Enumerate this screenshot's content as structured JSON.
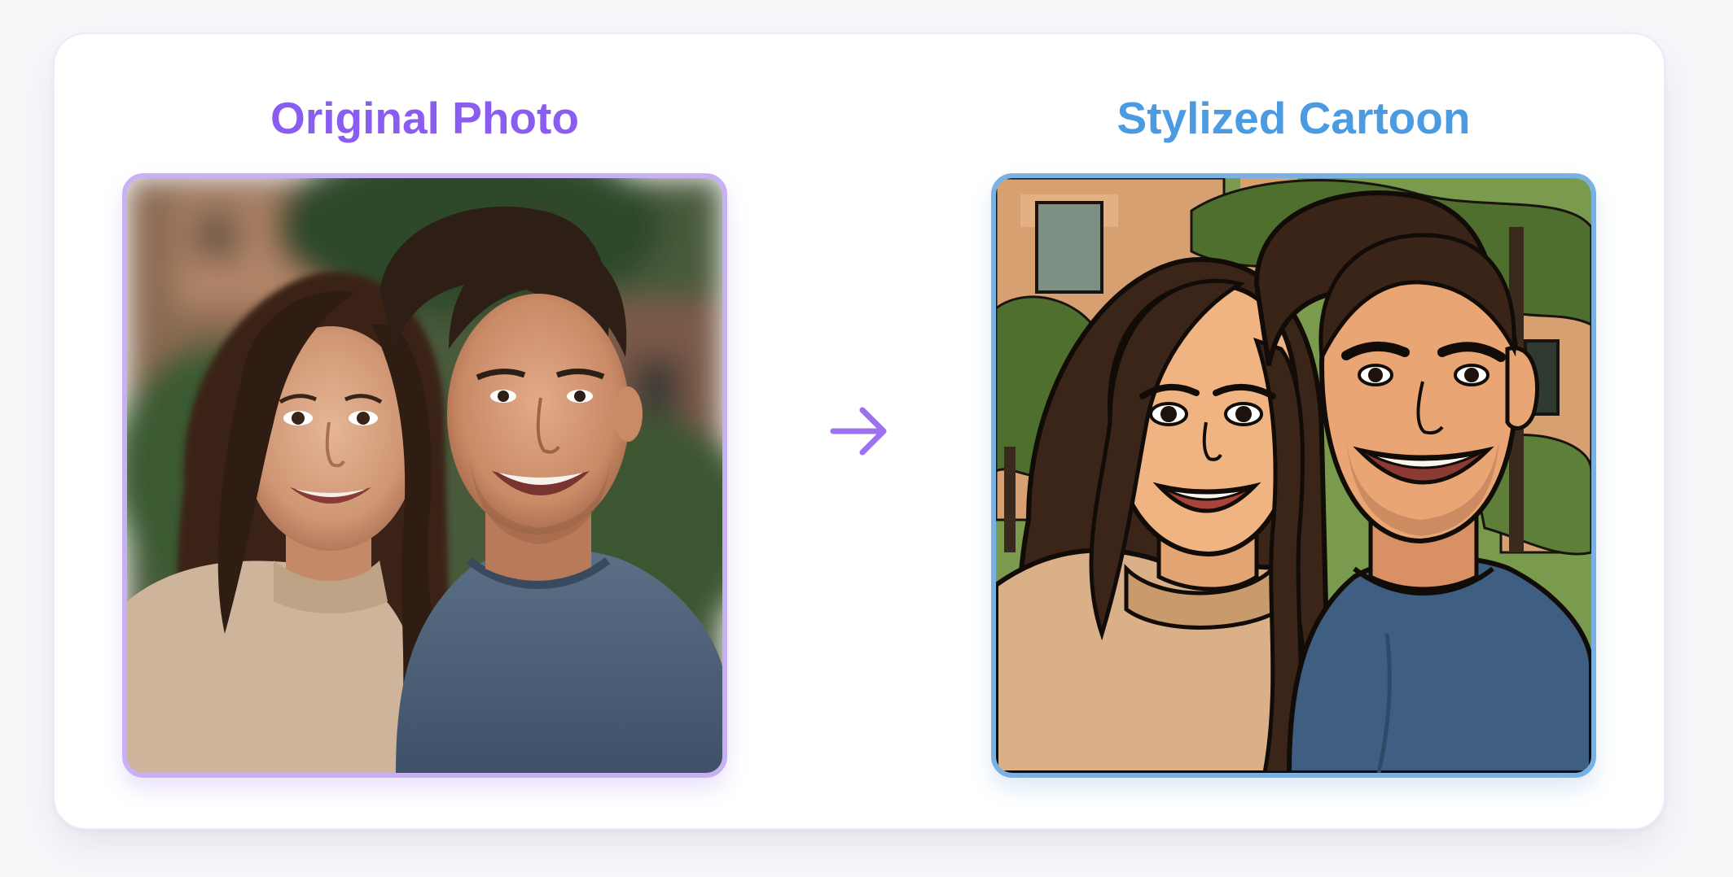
{
  "panel_left": {
    "title": "Original Photo",
    "title_color": "#8a5cf0",
    "border_color": "#c8b1f3",
    "image_description_icon": "couple-photo"
  },
  "panel_right": {
    "title": "Stylized Cartoon",
    "title_color": "#4a9be2",
    "border_color": "#78b1e3",
    "image_description_icon": "couple-cartoon"
  },
  "arrow": {
    "icon": "arrow-right-icon",
    "color": "#9c72ee"
  }
}
